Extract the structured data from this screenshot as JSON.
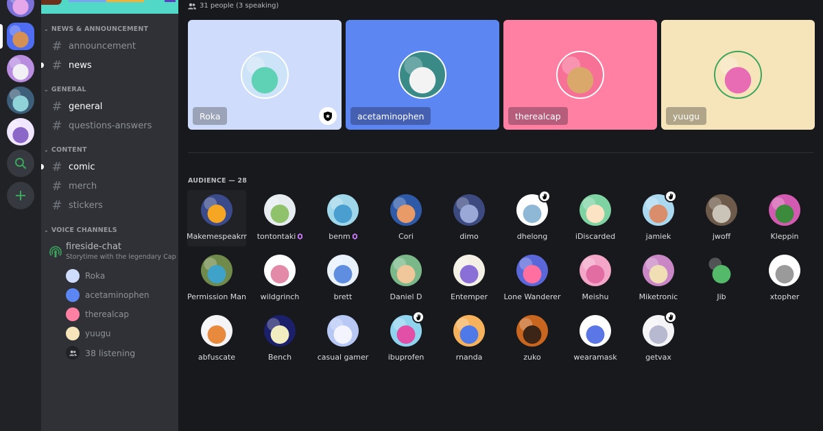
{
  "servers": [
    {
      "name": "server-1",
      "color": "#7b6fd8",
      "color2": "#e6a6ea"
    },
    {
      "name": "server-2",
      "color": "#4f6df0",
      "color2": "#d49055",
      "active": true
    },
    {
      "name": "server-3",
      "color": "#b98ee0",
      "color2": "#f0f0f5"
    },
    {
      "name": "server-4",
      "color": "#3e5f7a",
      "color2": "#8fd3d8"
    },
    {
      "name": "server-5",
      "color": "#f0e6ff",
      "color2": "#8b68c7"
    }
  ],
  "rail_buttons": {
    "explore_icon": "search-icon",
    "add_icon": "plus-icon"
  },
  "categories": [
    {
      "name": "NEWS & ANNOUNCEMENT",
      "channels": [
        {
          "name": "announcement",
          "bright": false,
          "unread": false
        },
        {
          "name": "news",
          "bright": true,
          "unread": true
        }
      ]
    },
    {
      "name": "GENERAL",
      "channels": [
        {
          "name": "general",
          "bright": true,
          "unread": false
        },
        {
          "name": "questions-answers",
          "bright": false,
          "unread": false
        }
      ]
    },
    {
      "name": "CONTENT",
      "channels": [
        {
          "name": "comic",
          "bright": true,
          "unread": true
        },
        {
          "name": "merch",
          "bright": false,
          "unread": false
        },
        {
          "name": "stickers",
          "bright": false,
          "unread": false
        }
      ]
    },
    {
      "name": "VOICE CHANNELS",
      "channels": []
    }
  ],
  "stage_channel": {
    "name": "fireside-chat",
    "topic": "Storytime with the legendary Cap",
    "speakers": [
      {
        "name": "Roka",
        "color": "#cfdcfb"
      },
      {
        "name": "acetaminophen",
        "color": "#5c86f2"
      },
      {
        "name": "therealcap",
        "color": "#ff80a3"
      },
      {
        "name": "yuugu",
        "color": "#f6e4bb"
      }
    ],
    "listening": "38 listening"
  },
  "main": {
    "people_count": "31 people (3 speaking)",
    "speakers": [
      {
        "name": "Roka",
        "bg": "#cfdcfb",
        "tag": "#9aa3b8",
        "av": "#cde3f7",
        "avfg": "#5fd1b4",
        "moderator": true,
        "speaking": false
      },
      {
        "name": "acetaminophen",
        "bg": "#5c86f2",
        "tag": "#4560b0",
        "av": "#3a8a88",
        "avfg": "#f3f3f3",
        "moderator": false,
        "speaking": false
      },
      {
        "name": "therealcap",
        "bg": "#ff80a3",
        "tag": "#b55d7a",
        "av": "#f77095",
        "avfg": "#d9a86a",
        "moderator": false,
        "speaking": false
      },
      {
        "name": "yuugu",
        "bg": "#f6e4bb",
        "tag": "#b0a588",
        "av": "#f6e4bb",
        "avfg": "#e86cb3",
        "moderator": false,
        "speaking": true
      }
    ],
    "audience_header": "AUDIENCE — 28",
    "audience": [
      {
        "name": "Makemespeakrr",
        "bg": "#3a4a8a",
        "fg": "#f5a623",
        "boost": false,
        "hand": false,
        "hover": true
      },
      {
        "name": "tontontaki",
        "bg": "#e6ecef",
        "fg": "#8fc26b",
        "boost": true,
        "hand": false
      },
      {
        "name": "benm",
        "bg": "#9fd6ea",
        "fg": "#4a9ed0",
        "boost": true,
        "hand": false
      },
      {
        "name": "Cori",
        "bg": "#2f5aa8",
        "fg": "#e89a67",
        "boost": false,
        "hand": false
      },
      {
        "name": "dimo",
        "bg": "#3d4a80",
        "fg": "#9aa8d8",
        "boost": false,
        "hand": false
      },
      {
        "name": "dhelong",
        "bg": "#ffffff",
        "fg": "#8fb8d6",
        "boost": false,
        "hand": true
      },
      {
        "name": "iDiscarded",
        "bg": "#7fd3a3",
        "fg": "#fbe3c4",
        "boost": false,
        "hand": false
      },
      {
        "name": "jamiek",
        "bg": "#a9d8ef",
        "fg": "#d98d6b",
        "boost": false,
        "hand": true
      },
      {
        "name": "jwoff",
        "bg": "#6e5a4a",
        "fg": "#c9c3b8",
        "boost": false,
        "hand": false
      },
      {
        "name": "Kleppin",
        "bg": "#d25ab0",
        "fg": "#3c8a3c",
        "boost": false,
        "hand": false
      },
      {
        "name": "Permission Man",
        "bg": "#6f8a4a",
        "fg": "#3fa2c8",
        "boost": false,
        "hand": false
      },
      {
        "name": "wildgrinch",
        "bg": "#ffffff",
        "fg": "#e48aa9",
        "boost": false,
        "hand": false
      },
      {
        "name": "brett",
        "bg": "#e9f2fb",
        "fg": "#5f8ee0",
        "boost": false,
        "hand": false
      },
      {
        "name": "Daniel D",
        "bg": "#7ab88a",
        "fg": "#f0c79a",
        "boost": false,
        "hand": false
      },
      {
        "name": "Entemper",
        "bg": "#f4f0e6",
        "fg": "#8a6fd6",
        "boost": false,
        "hand": false
      },
      {
        "name": "Lone Wanderer",
        "bg": "#5967d8",
        "fg": "#ff6fa0",
        "boost": false,
        "hand": false
      },
      {
        "name": "Meishu",
        "bg": "#f3a6c8",
        "fg": "#e16da3",
        "boost": false,
        "hand": false
      },
      {
        "name": "Miketronic",
        "bg": "#c987c6",
        "fg": "#f0dfb5",
        "boost": false,
        "hand": false
      },
      {
        "name": "Jib",
        "bg": "#18191c",
        "fg": "#55b96a",
        "boost": false,
        "hand": false
      },
      {
        "name": "xtopher",
        "bg": "#ffffff",
        "fg": "#9a9a9a",
        "boost": false,
        "hand": false
      },
      {
        "name": "abfuscate",
        "bg": "#f4f4f7",
        "fg": "#e88a3d",
        "boost": false,
        "hand": false
      },
      {
        "name": "Bench",
        "bg": "#1c1f6a",
        "fg": "#f1edc0",
        "boost": false,
        "hand": false
      },
      {
        "name": "casual gamer",
        "bg": "#b7c8f5",
        "fg": "#f4f4ff",
        "boost": false,
        "hand": false
      },
      {
        "name": "ibuprofen",
        "bg": "#8fd3ee",
        "fg": "#e24fa6",
        "boost": false,
        "hand": true
      },
      {
        "name": "rnanda",
        "bg": "#f5b15c",
        "fg": "#4e79e6",
        "boost": false,
        "hand": false
      },
      {
        "name": "zuko",
        "bg": "#c8651e",
        "fg": "#3c2517",
        "boost": false,
        "hand": false
      },
      {
        "name": "wearamask",
        "bg": "#ffffff",
        "fg": "#5b77e6",
        "boost": false,
        "hand": false
      },
      {
        "name": "getvax",
        "bg": "#f4f4f7",
        "fg": "#b7b9d0",
        "boost": false,
        "hand": true
      }
    ]
  },
  "colors": {
    "rail": "#202225",
    "sidebar": "#2f3136",
    "main": "#18191c",
    "accent_green": "#3ba55c",
    "boost_pink": "#d07bff"
  }
}
